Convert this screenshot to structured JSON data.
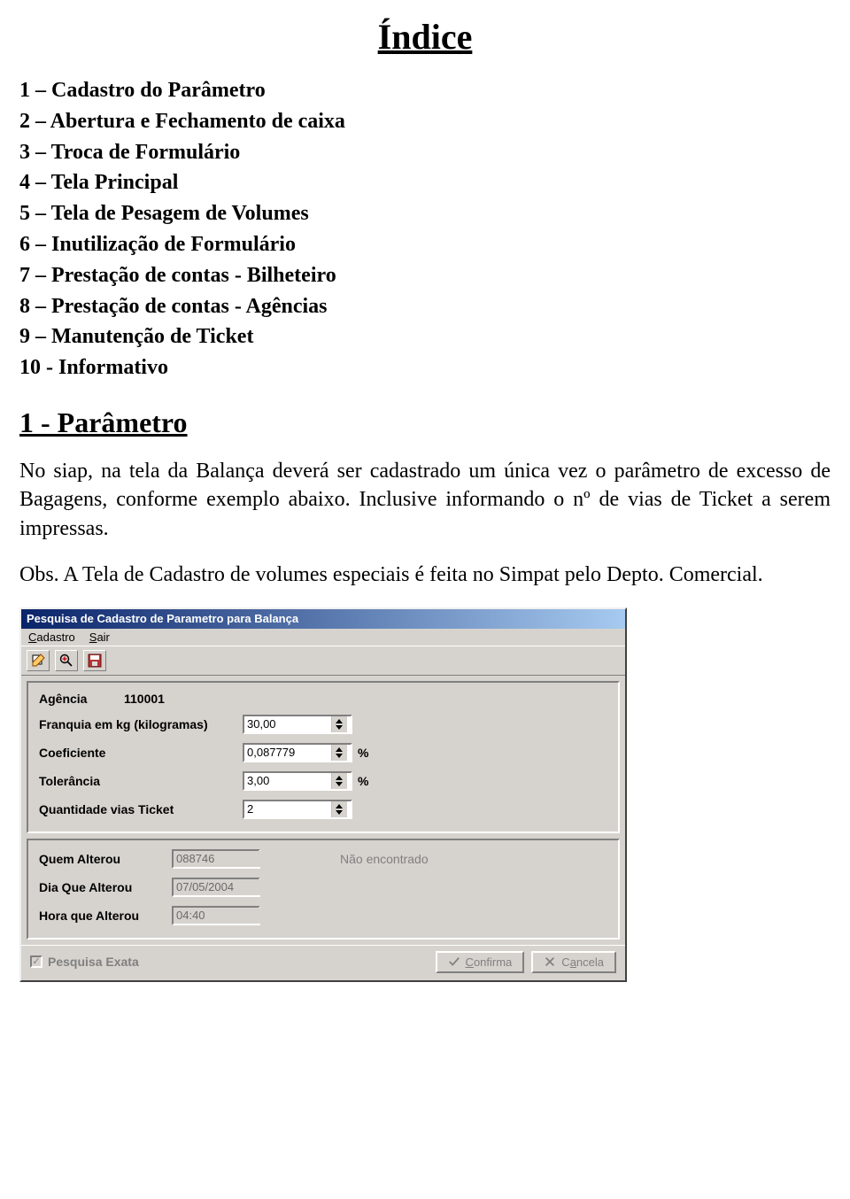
{
  "title": "Índice",
  "index": [
    "1 – Cadastro do Parâmetro",
    "2 – Abertura e Fechamento de caixa",
    "3 – Troca de Formulário",
    "4 – Tela Principal",
    "5 – Tela de Pesagem de Volumes",
    "6 – Inutilização de Formulário",
    "7 – Prestação de contas - Bilheteiro",
    "8 – Prestação de contas - Agências",
    "9 – Manutenção de Ticket",
    "10 - Informativo"
  ],
  "section_heading": "1 - Parâmetro",
  "para1": "No siap, na tela da Balança deverá ser cadastrado um única vez o parâmetro de excesso de Bagagens, conforme exemplo abaixo. Inclusive informando o nº de vias de Ticket a serem impressas.",
  "para2": "Obs. A Tela de Cadastro de volumes especiais é feita no Simpat pelo Depto. Comercial.",
  "dialog": {
    "title": "Pesquisa de Cadastro de Parametro para Balança",
    "menu": {
      "cadastro": "Cadastro",
      "sair": "Sair"
    },
    "labels": {
      "agencia": "Agência",
      "franquia": "Franquia em kg (kilogramas)",
      "coeficiente": "Coeficiente",
      "tolerancia": "Tolerância",
      "qtd_vias": "Quantidade vias Ticket",
      "quem": "Quem Alterou",
      "dia": "Dia Que Alterou",
      "hora": "Hora que Alterou",
      "pesquisa": "Pesquisa Exata",
      "nao_encontrado": "Não encontrado",
      "pct": "%"
    },
    "values": {
      "agencia": "110001",
      "franquia": "30,00",
      "coeficiente": "0,087779",
      "tolerancia": "3,00",
      "qtd_vias": "2",
      "quem": "088746",
      "dia": "07/05/2004",
      "hora": "04:40"
    },
    "buttons": {
      "confirma": "Confirma",
      "cancela": "Cancela"
    }
  }
}
